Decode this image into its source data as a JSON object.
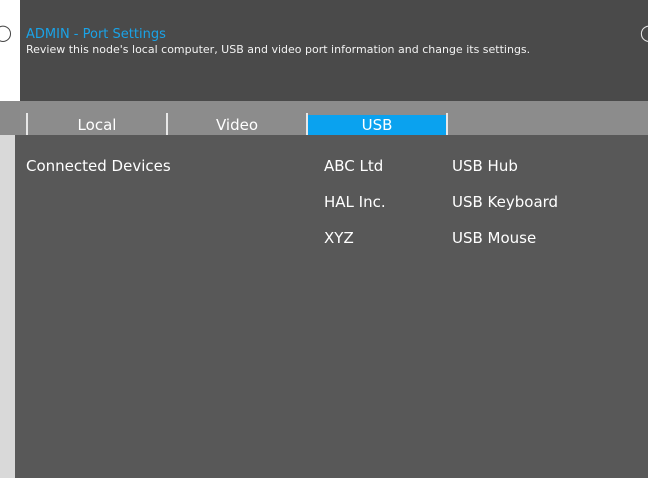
{
  "header": {
    "title": "ADMIN - Port Settings",
    "subtitle": "Review this node's local computer, USB and video port information and change its settings."
  },
  "tabs": [
    {
      "label": "Local",
      "active": false
    },
    {
      "label": "Video",
      "active": false
    },
    {
      "label": "USB",
      "active": true
    }
  ],
  "usb": {
    "section_label": "Connected Devices",
    "devices": [
      {
        "vendor": "ABC Ltd",
        "type": "USB Hub"
      },
      {
        "vendor": "HAL Inc.",
        "type": "USB Keyboard"
      },
      {
        "vendor": "XYZ",
        "type": "USB Mouse"
      }
    ]
  },
  "colors": {
    "accent": "#0aa2ef",
    "title": "#1aa3e8",
    "panel": "#585858",
    "tabbar": "#8c8c8c"
  }
}
